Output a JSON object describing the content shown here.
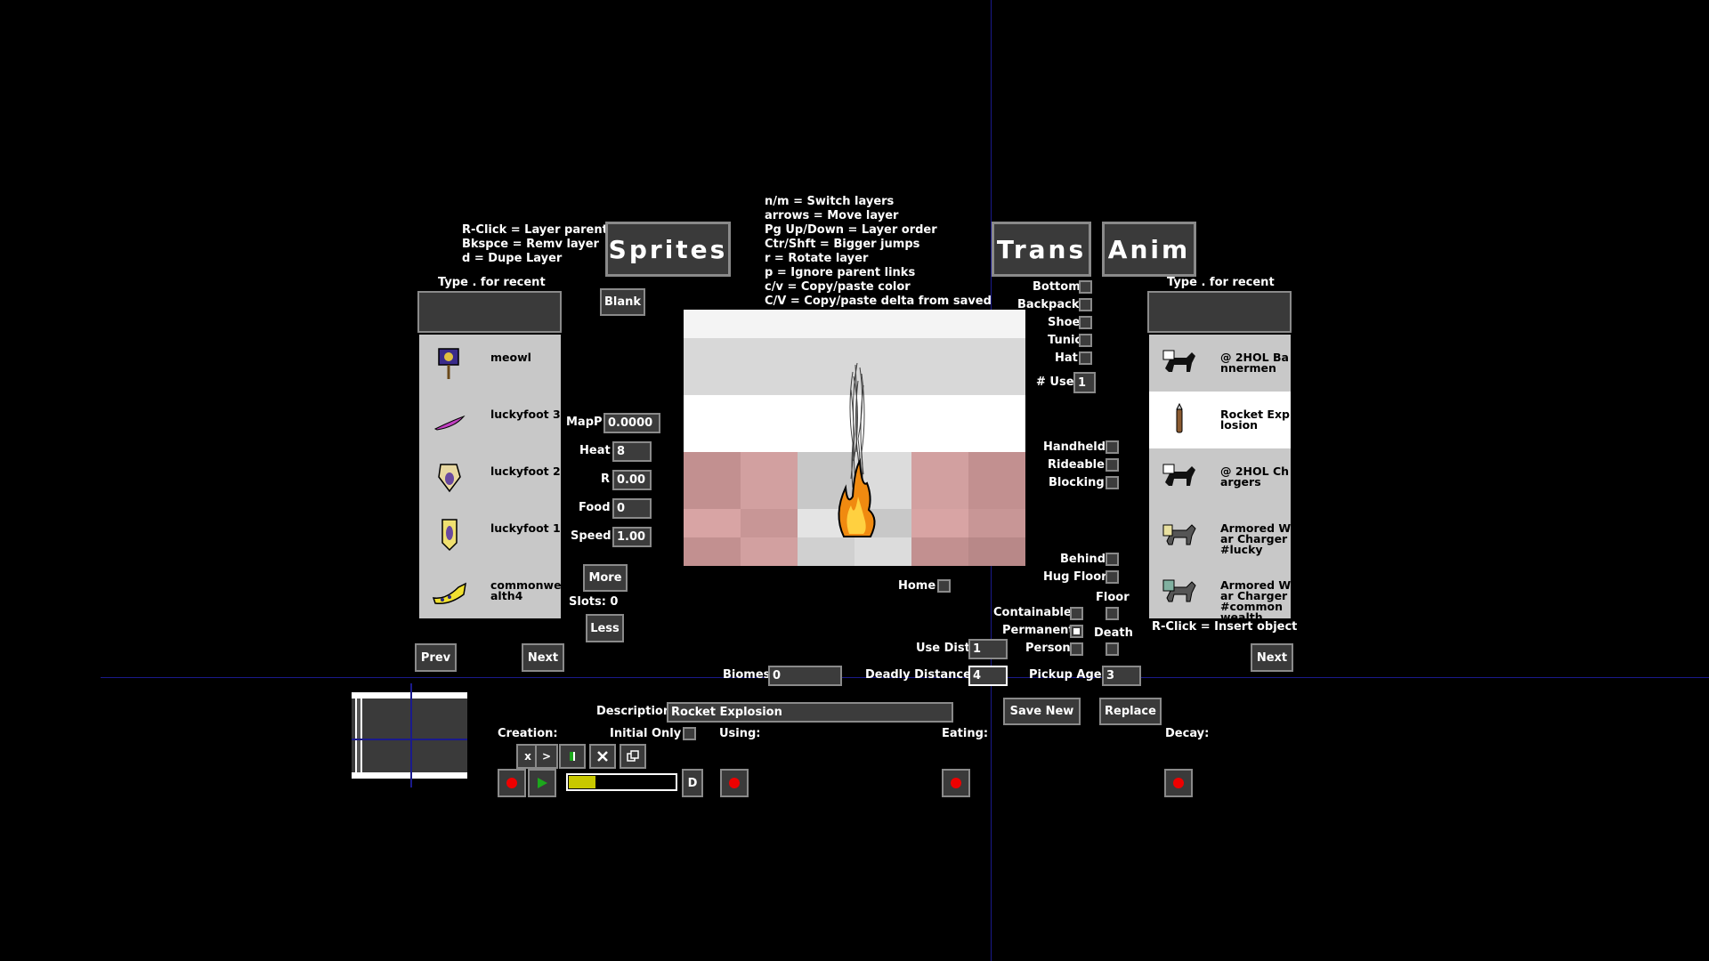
{
  "help_left": "R-Click = Layer parent\nBkspce = Remv layer\nd = Dupe Layer",
  "help_center": "n/m = Switch layers\narrows = Move layer\nPg Up/Down = Layer order\nCtr/Shft = Bigger jumps\nr = Rotate layer\np = Ignore parent links\nc/v = Copy/paste color\nC/V = Copy/paste delta from saved",
  "buttons": {
    "sprites": "Sprites",
    "trans": "Trans",
    "anim": "Anim",
    "blank": "Blank",
    "more": "More",
    "less": "Less",
    "prev": "Prev",
    "next_left": "Next",
    "next_right": "Next",
    "save_new": "Save New",
    "replace": "Replace",
    "d": "D",
    "x": "x",
    "gt": ">"
  },
  "left_panel": {
    "type_hint": "Type . for recent",
    "search_value": "",
    "items": [
      {
        "name": "meowl",
        "icon": "flag-icon"
      },
      {
        "name": "luckyfoot 3",
        "icon": "feather-icon"
      },
      {
        "name": "luckyfoot 2",
        "icon": "rabbit-badge-icon"
      },
      {
        "name": "luckyfoot 1",
        "icon": "rabbit-pennant-icon"
      },
      {
        "name": "commonwealth4",
        "icon": "horn-icon"
      }
    ]
  },
  "right_panel": {
    "type_hint": "Type . for recent",
    "search_value": "",
    "footer": "R-Click = Insert object",
    "items": [
      {
        "name": "@ 2HOL Bannermen",
        "icon": "horse-icon"
      },
      {
        "name": "Rocket Explosion",
        "icon": "rocket-icon"
      },
      {
        "name": "@ 2HOL Chargers",
        "icon": "horse-icon"
      },
      {
        "name": "Armored War Charger #lucky",
        "icon": "armored-horse-icon"
      },
      {
        "name": "Armored War Charger #commonwealth",
        "icon": "armored-horse-icon"
      }
    ]
  },
  "fields": {
    "mapp_label": "MapP",
    "mapp": "0.0000",
    "heat_label": "Heat",
    "heat": "8",
    "r_label": "R",
    "r": "0.00",
    "food_label": "Food",
    "food": "0",
    "speed_label": "Speed",
    "speed": "1.00",
    "slots": "Slots: 0",
    "use_label": "# Use",
    "use": "1",
    "use_dist_label": "Use Dist",
    "use_dist": "1",
    "biomes_label": "Biomes",
    "biomes": "0",
    "deadly_label": "Deadly Distance",
    "deadly": "4",
    "pickup_label": "Pickup Age",
    "pickup": "3",
    "description_label": "Description",
    "description": "Rocket Explosion"
  },
  "checks": {
    "bottom": "Bottom",
    "backpack": "Backpack",
    "shoe": "Shoe",
    "tunic": "Tunic",
    "hat": "Hat",
    "handheld": "Handheld",
    "rideable": "Rideable",
    "blocking": "Blocking",
    "behind": "Behind",
    "hug_floor": "Hug Floor",
    "floor": "Floor",
    "home": "Home",
    "containable": "Containable",
    "permanent": "Permanent",
    "death": "Death",
    "person": "Person"
  },
  "sound": {
    "creation": "Creation:",
    "initial_only": "Initial Only",
    "using": "Using:",
    "eating": "Eating:",
    "decay": "Decay:",
    "volume": 0.25
  },
  "colors": {
    "accent_line": "#1a1a8c",
    "volume_fill": "#c8c800",
    "record": "#e00000",
    "play": "#1ca81c"
  }
}
